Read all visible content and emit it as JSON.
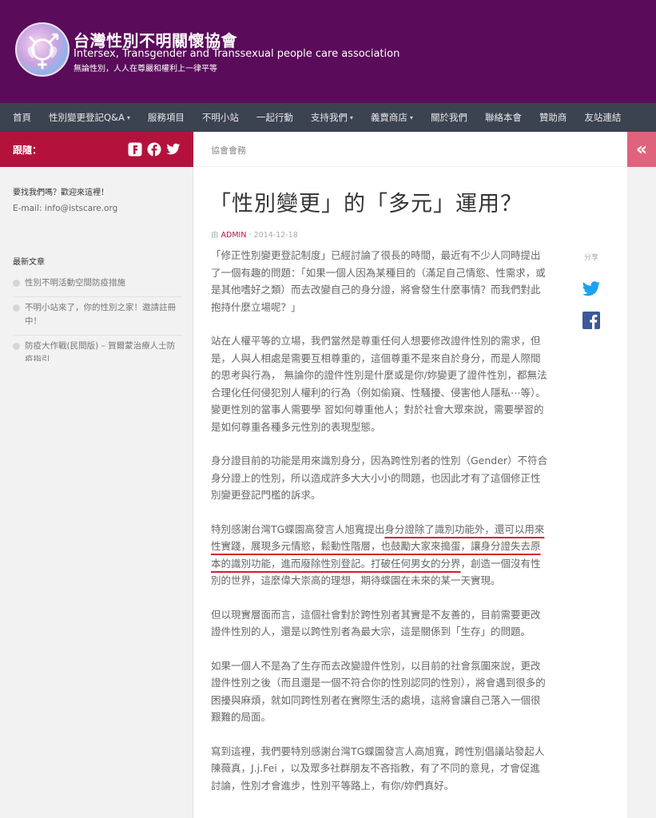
{
  "site": {
    "title": "台灣性別不明關懷協會",
    "subtitle": "Intersex, Transgender and Transsexual people care association",
    "tagline": "無論性別，人人在尊嚴和權利上一律平等"
  },
  "nav": {
    "items": [
      {
        "label": "首頁",
        "dropdown": false
      },
      {
        "label": "性別變更登記Q&A",
        "dropdown": true
      },
      {
        "label": "服務項目",
        "dropdown": false
      },
      {
        "label": "不明小站",
        "dropdown": false
      },
      {
        "label": "一起行動",
        "dropdown": false
      },
      {
        "label": "支持我們",
        "dropdown": true
      },
      {
        "label": "義賣商店",
        "dropdown": true
      },
      {
        "label": "關於我們",
        "dropdown": false
      },
      {
        "label": "聯絡本會",
        "dropdown": false
      },
      {
        "label": "贊助商",
        "dropdown": false
      },
      {
        "label": "友站連結",
        "dropdown": false
      }
    ],
    "caret": "▾"
  },
  "sidebar": {
    "follow_label": "跟隨：",
    "social_icons": [
      "flickr-icon",
      "facebook-icon",
      "twitter-icon"
    ],
    "contact_heading": "要找我們嗎？歡迎來這裡！",
    "contact_email": "E-mail: info@istscare.org",
    "recent_heading": "最新文章",
    "recent_posts": [
      "性別不明活動空間防疫措施",
      "不明小站來了，你的性別之家！邀請註冊中！",
      "防疫大作戰(民間版) – 賀爾蒙治療人士防疫指引"
    ]
  },
  "main": {
    "breadcrumb": "協會會務",
    "title": "「性別變更」的「多元」運用？",
    "byline_prefix": "由",
    "author": "ADMIN",
    "date": "2014-12-18",
    "share_label": "分享",
    "paragraphs": {
      "p1": "「修正性別變更登記制度」已經討論了很長的時間，最近有不少人同時提出了一個有趣的問題：「如果一個人因為某種目的（滿足自己情慾、性需求，或是其他嗜好之類）而去改變自己的身分證，將會發生什麼事情？而我們對此抱持什麼立場呢？」",
      "p2": "站在人權平等的立場，我們當然是尊重任何人想要修改證件性別的需求，但是，人與人相處是需要互相尊重的，這個尊重不是來自於身分，而是人際間的思考與行為， 無論你的證件性別是什麼或是你/妳變更了證件性別，都無法合理化任何侵犯別人權利的行為（例如偷窺、性騷擾、侵害他人隱私⋯等）。變更性別的當事人需要學 習如何尊重他人；對於社會大眾來說，需要學習的是如何尊重各種多元性別的表現型態。",
      "p3": "身分證目前的功能是用來識別身分，因為跨性別者的性別（Gender）不符合身分證上的性別，所以造成許多大大小小的問題，也因此才有了這個修正性別變更登記門檻的訴求。",
      "p4_pre": "特別感謝台灣TG蝶園高發言人旭寬提出",
      "p4_hl": "身分證除了識別功能外，還可以用來性實踐，展現多元情慾，鬆動性階層，也鼓勵大家來搗蛋，讓身分證失去原本的識別功能，進而廢除性別登記。打破任何男女的分界",
      "p4_post": "，創造一個沒有性別的世界，這麼偉大崇高的理想，期待蝶園在未來的某一天實現。",
      "p5": "但以現實層面而言，這個社會對於跨性別者其實是不友善的，目前需要更改證件性別的人，還是以跨性別者為最大宗，這是關係到「生存」的問題。",
      "p6": "如果一個人不是為了生存而去改變證件性別，以目前的社會氛圍來說，更改證件性別之後（而且還是一個不符合你的性別認同的性別），將會遇到很多的困擾與麻煩，就如同跨性別者在實際生活的處境，這將會讓自己落入一個很艱難的局面。",
      "p7": "寫到這裡，我們要特別感謝台灣TG蝶園發言人高旭寬，跨性別倡議站發起人陳薇真，J.j.Fei ，以及眾多社群朋友不吝指教，有了不同的意見，才會促進討論，性別才會進步，性別平等路上，有你/妳們真好。"
    }
  },
  "right_sidebar": {
    "toggle_glyph": "«"
  },
  "colors": {
    "header_bg": "#5a0b5a",
    "nav_bg": "#3b4250",
    "accent": "#b4123c",
    "toggle_bg": "#e0637e",
    "underline": "#d81b2e",
    "twitter": "#1da1f2",
    "facebook": "#3b5998"
  }
}
